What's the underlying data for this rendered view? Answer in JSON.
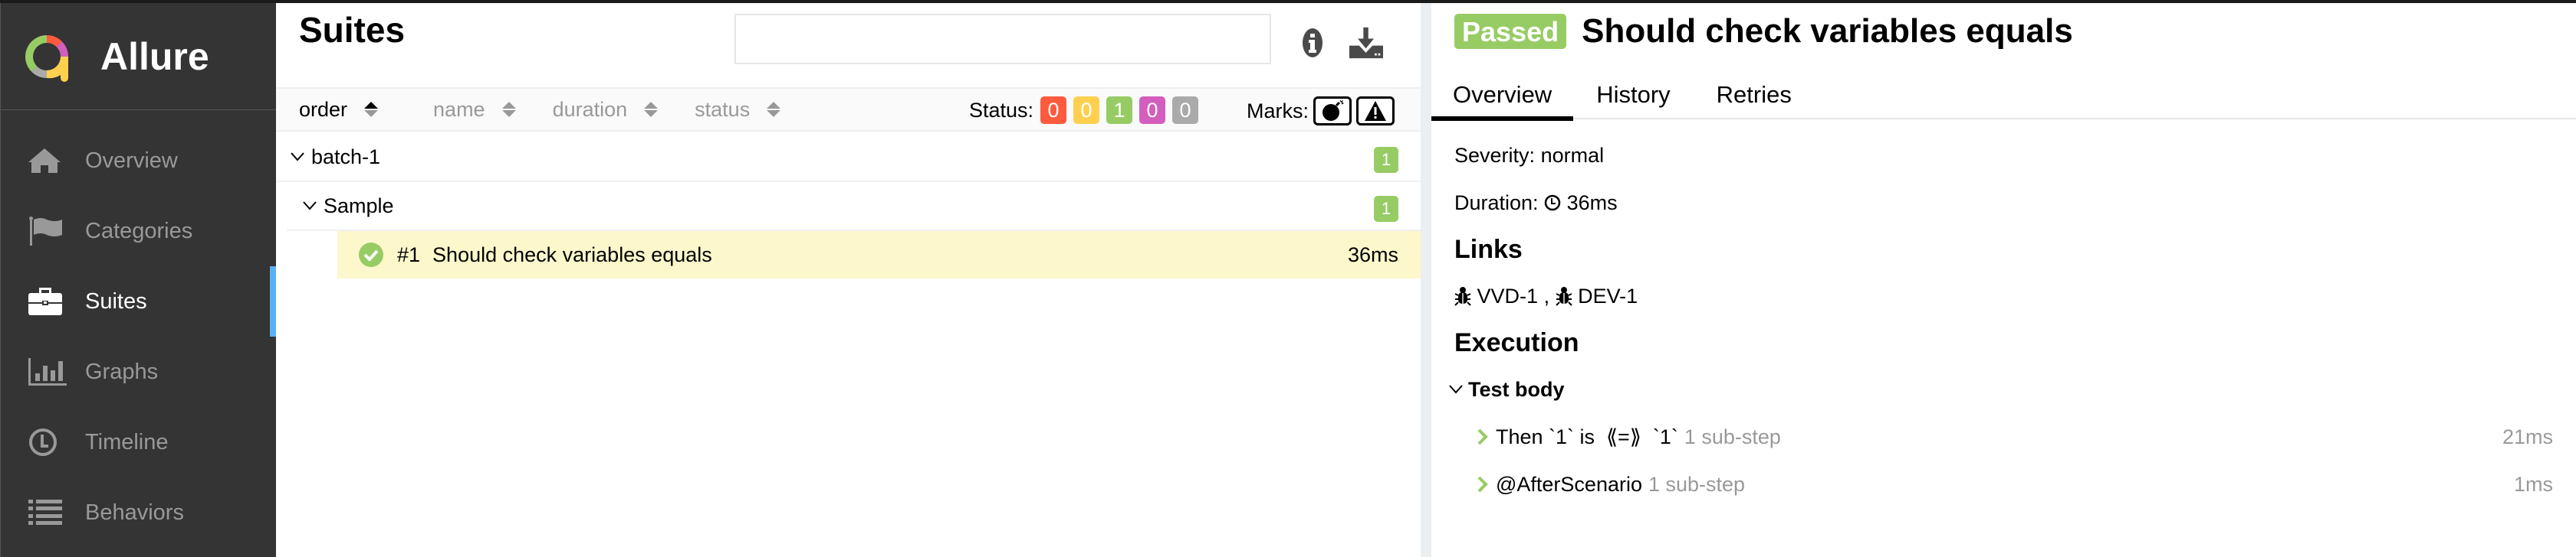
{
  "app": {
    "name": "Allure",
    "logo_colors": [
      "#97cc64",
      "#fd5a3e",
      "#d35ebe",
      "#ffd050",
      "#aaaaaa"
    ]
  },
  "sidebar": {
    "items": [
      {
        "label": "Overview",
        "icon": "home-icon",
        "active": false
      },
      {
        "label": "Categories",
        "icon": "flag-icon",
        "active": false
      },
      {
        "label": "Suites",
        "icon": "briefcase-icon",
        "active": true
      },
      {
        "label": "Graphs",
        "icon": "bar-chart-icon",
        "active": false
      },
      {
        "label": "Timeline",
        "icon": "clock-icon",
        "active": false
      },
      {
        "label": "Behaviors",
        "icon": "list-icon",
        "active": false
      }
    ],
    "accent": "#59b1f2"
  },
  "suites": {
    "title": "Suites",
    "search": {
      "value": "",
      "placeholder": ""
    },
    "sort": [
      {
        "label": "order",
        "active": true
      },
      {
        "label": "name",
        "active": false
      },
      {
        "label": "duration",
        "active": false
      },
      {
        "label": "status",
        "active": false
      }
    ],
    "status_label": "Status:",
    "status_counts": [
      {
        "status": "failed",
        "count": "0",
        "color": "#fd5a3e"
      },
      {
        "status": "broken",
        "count": "0",
        "color": "#ffd050"
      },
      {
        "status": "passed",
        "count": "1",
        "color": "#97cc64"
      },
      {
        "status": "skipped",
        "count": "0",
        "color": "#d35ebe"
      },
      {
        "status": "unknown",
        "count": "0",
        "color": "#aaaaaa"
      }
    ],
    "marks_label": "Marks:",
    "marks": [
      "flaky-bomb-icon",
      "new-failed-warning-icon"
    ],
    "tree": {
      "group": {
        "name": "batch-1",
        "count": "1"
      },
      "subgroup": {
        "name": "Sample",
        "count": "1"
      },
      "test": {
        "number": "#1",
        "name": "Should check variables equals",
        "duration": "36ms",
        "status": "passed"
      }
    }
  },
  "testcase": {
    "status_badge": "Passed",
    "title": "Should check variables equals",
    "tabs": [
      {
        "label": "Overview",
        "active": true
      },
      {
        "label": "History",
        "active": false
      },
      {
        "label": "Retries",
        "active": false
      }
    ],
    "severity_label": "Severity:",
    "severity": "normal",
    "duration_label": "Duration:",
    "duration": "36ms",
    "links_heading": "Links",
    "links": [
      "VVD-1",
      "DEV-1"
    ],
    "links_separator": ",",
    "execution_heading": "Execution",
    "test_body_label": "Test body",
    "steps": [
      {
        "name": "Then `1` is  ⟪=⟫  `1`",
        "sub": "1 sub-step",
        "duration": "21ms"
      },
      {
        "name": "@AfterScenario",
        "sub": "1 sub-step",
        "duration": "1ms"
      }
    ]
  }
}
